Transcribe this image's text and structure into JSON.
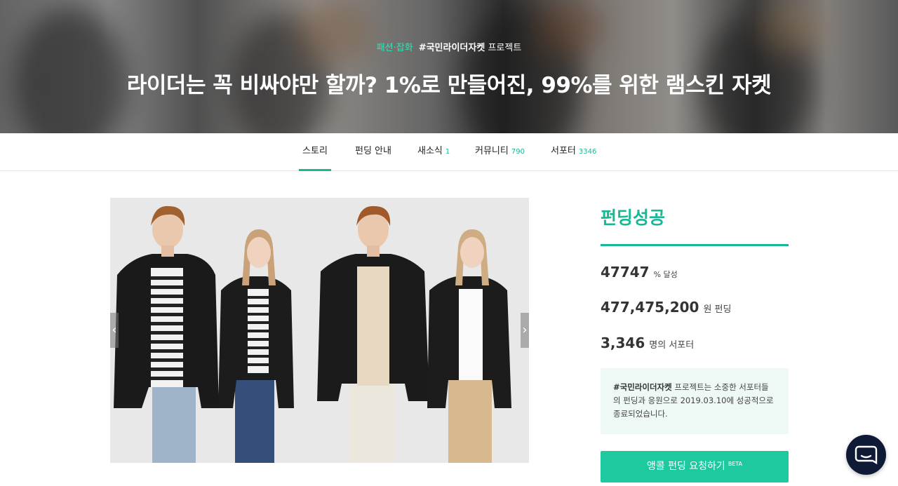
{
  "hero": {
    "category": "패션·잡화",
    "tag": "#국민라이더자켓",
    "tag_suffix": " 프로젝트",
    "title": "라이더는 꼭 비싸야만 할까? 1%로 만들어진, 99%를 위한 램스킨 자켓"
  },
  "tabs": [
    {
      "label": "스토리",
      "count": ""
    },
    {
      "label": "펀딩 안내",
      "count": ""
    },
    {
      "label": "새소식",
      "count": "1"
    },
    {
      "label": "커뮤니티",
      "count": "790"
    },
    {
      "label": "서포터",
      "count": "3346"
    }
  ],
  "sidebar": {
    "status": "펀딩성공",
    "achieve_num": "47747",
    "achieve_unit": "% 달성",
    "amount_num": "477,475,200",
    "amount_unit": "원 펀딩",
    "supporters_num": "3,346",
    "supporters_unit": "명의 서포터",
    "notice_tag": "#국민라이더자켓",
    "notice_text": " 프로젝트는 소중한 서포터들의 펀딩과 응원으로 2019.03.10에 성공적으로 종료되었습니다.",
    "encore_label": "앵콜 펀딩 요청하기",
    "encore_badge": "BETA"
  },
  "media": {
    "prev_icon": "‹",
    "next_icon": "›"
  },
  "colors": {
    "accent": "#1ab794",
    "button": "#1ec9a0",
    "notice_bg": "#eef9f6",
    "chat_bg": "#0f1b36"
  }
}
